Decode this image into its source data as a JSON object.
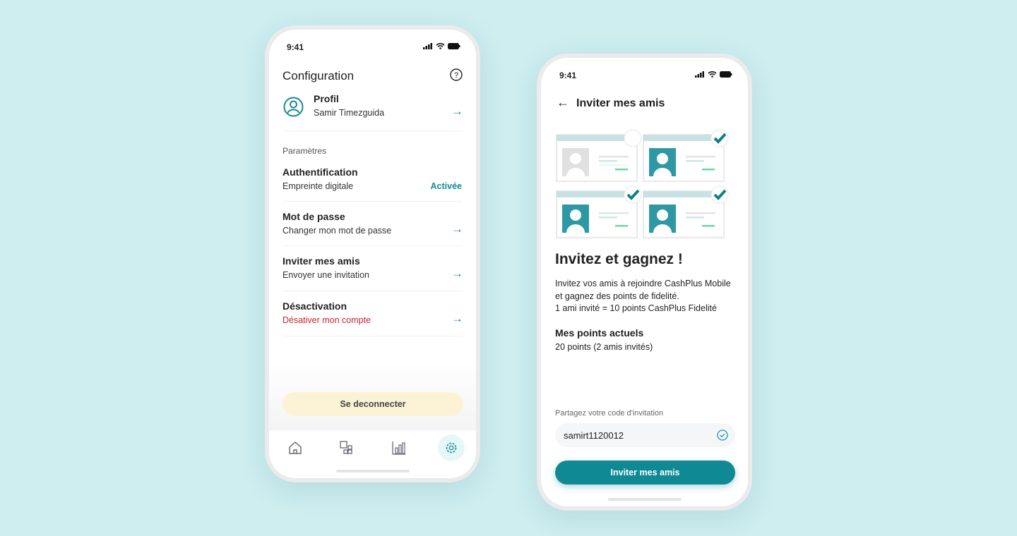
{
  "colors": {
    "accent": "#0f8a94",
    "danger": "#c8262f",
    "logout_bg": "#fcf3d7",
    "background": "#ceeef0"
  },
  "config": {
    "status_time": "9:41",
    "title": "Configuration",
    "help_icon": "question-circle-icon",
    "profile": {
      "title": "Profil",
      "name": "Samir Timezguida"
    },
    "section_label": "Paramètres",
    "rows": [
      {
        "title": "Authentification",
        "subtitle": "Empreinte digitale",
        "value": "Activée"
      },
      {
        "title": "Mot de passe",
        "subtitle": "Changer mon mot de passe"
      },
      {
        "title": "Inviter mes amis",
        "subtitle": "Envoyer une invitation"
      },
      {
        "title": "Désactivation",
        "subtitle": "Désativer mon compte"
      }
    ],
    "logout_label": "Se deconnecter",
    "nav": [
      "home-icon",
      "apps-icon",
      "chart-icon",
      "gear-icon"
    ],
    "nav_active": "gear-icon"
  },
  "invite": {
    "status_time": "9:41",
    "title": "Inviter mes amis",
    "heading": "Invitez et gagnez !",
    "description": [
      "Invitez vos amis à rejoindre CashPlus Mobile",
      "et gagnez des points de fidelité.",
      "1 ami invité = 10 points CashPlus Fidelité"
    ],
    "points_title": "Mes points actuels",
    "points_value": "20 points (2 amis invités)",
    "code_label": "Partagez votre code d'invitation",
    "code_value": "samirt1120012",
    "button_label": "Inviter mes amis"
  }
}
